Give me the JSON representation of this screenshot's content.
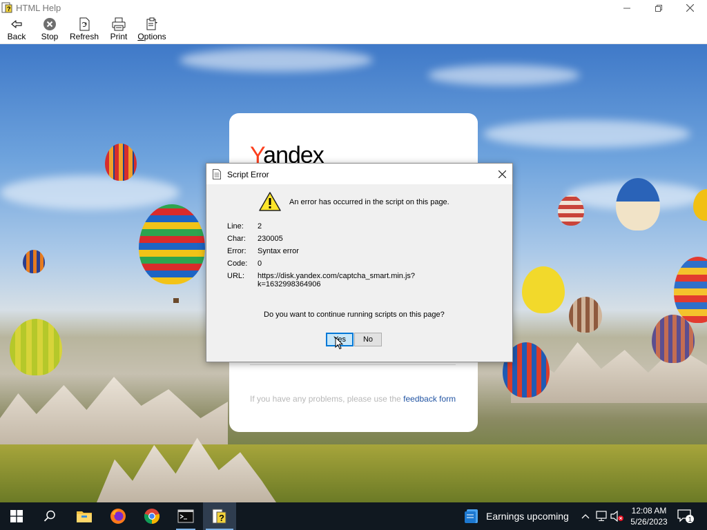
{
  "window": {
    "title": "HTML Help",
    "app_icon": "help-document-icon",
    "controls": [
      "minimize-icon",
      "restore-icon",
      "close-icon"
    ]
  },
  "toolbar": {
    "items": [
      {
        "label": "Back",
        "icon": "back-arrow-icon"
      },
      {
        "label": "Stop",
        "icon": "stop-icon"
      },
      {
        "label": "Refresh",
        "icon": "refresh-icon"
      },
      {
        "label": "Print",
        "icon": "printer-icon"
      },
      {
        "label": "Options",
        "icon": "options-icon"
      }
    ]
  },
  "page": {
    "logo": {
      "first": "Y",
      "rest": "andex"
    },
    "problem_text": "If you have any problems, please use the ",
    "feedback_link": "feedback form",
    "colors": {
      "logo_accent": "#fc3f1d",
      "link": "#2355a3"
    }
  },
  "dialog": {
    "title": "Script Error",
    "message": "An error has occurred in the script on this page.",
    "fields": [
      {
        "key": "Line:",
        "value": "2"
      },
      {
        "key": "Char:",
        "value": "230005"
      },
      {
        "key": "Error:",
        "value": "Syntax error"
      },
      {
        "key": "Code:",
        "value": "0"
      },
      {
        "key": "URL:",
        "value": "https://disk.yandex.com/captcha_smart.min.js?",
        "value2": "k=1632998364906"
      }
    ],
    "question": "Do you want to continue running scripts on this page?",
    "yes_label": "Yes",
    "no_label": "No"
  },
  "taskbar": {
    "apps": [
      "windows-start-icon",
      "search-icon",
      "file-explorer-icon",
      "firefox-icon",
      "chrome-icon",
      "terminal-icon",
      "html-help-icon"
    ],
    "news": "Earnings upcoming",
    "clock": {
      "time": "12:08 AM",
      "date": "5/26/2023"
    },
    "notifications": "1"
  }
}
